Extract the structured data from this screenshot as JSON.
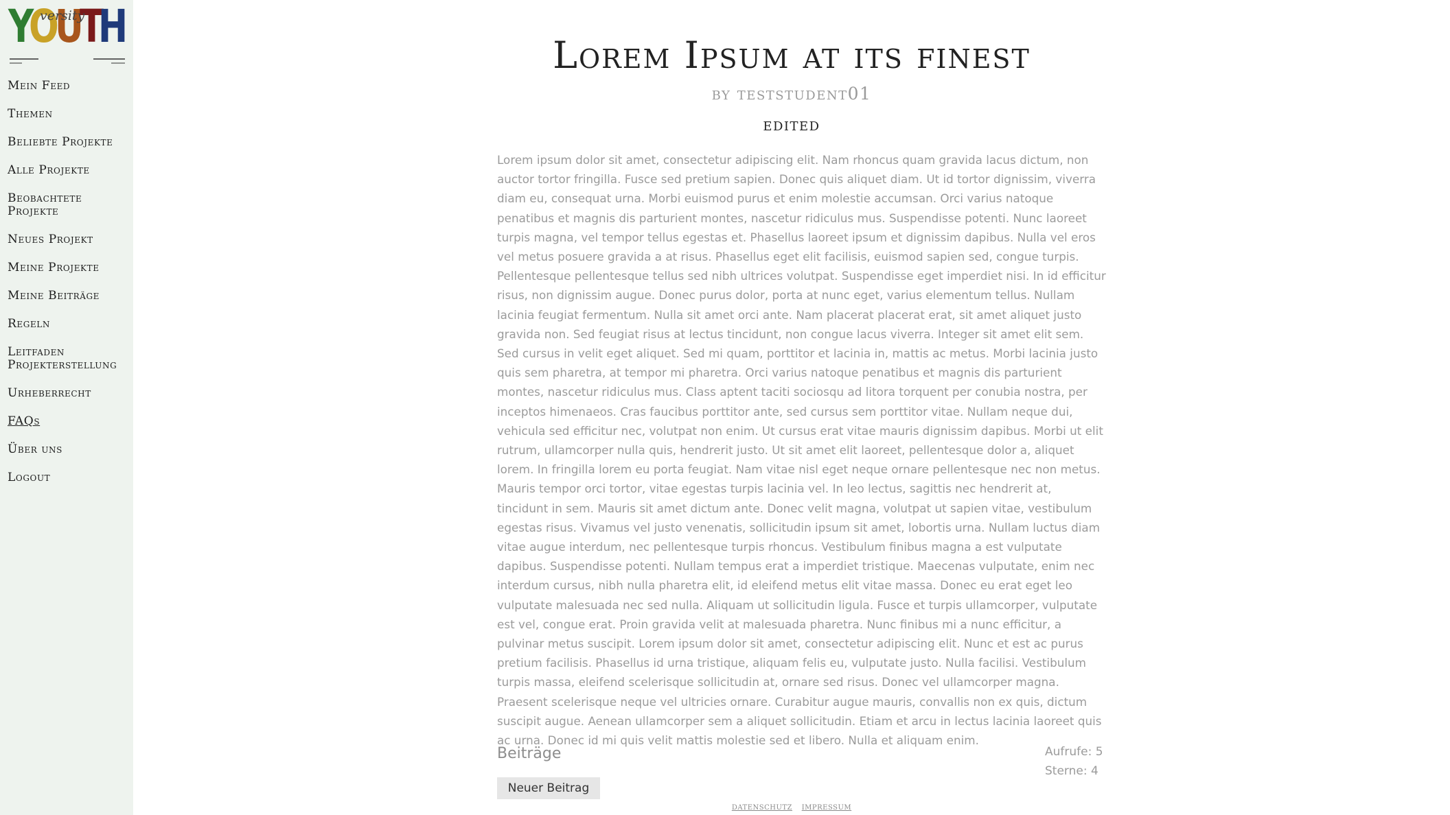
{
  "brand": {
    "logo_main": "YOUTH",
    "logo_sub": "versity",
    "logo_letter_colors": [
      "#2f7d32",
      "#c9a227",
      "#a8561c",
      "#7a1a1a",
      "#1f3a7a"
    ]
  },
  "sidebar": {
    "items": [
      {
        "label": "Mein Feed"
      },
      {
        "label": "Themen"
      },
      {
        "label": "Beliebte Projekte"
      },
      {
        "label": "Alle Projekte"
      },
      {
        "label": "Beobachtete Projekte"
      },
      {
        "label": "Neues Projekt"
      },
      {
        "label": "Meine Projekte"
      },
      {
        "label": "Meine Beiträge"
      },
      {
        "label": "Regeln"
      },
      {
        "label": "Leitfaden Projekterstellung"
      },
      {
        "label": "Urheberrecht"
      },
      {
        "label": "FAQs"
      },
      {
        "label": "Über uns"
      },
      {
        "label": "Logout"
      }
    ]
  },
  "article": {
    "title": "Lorem Ipsum at its finest",
    "byline": "by teststudent01",
    "status": "EDITED",
    "body": "Lorem ipsum dolor sit amet, consectetur adipiscing elit. Nam rhoncus quam gravida lacus dictum, non auctor tortor fringilla. Fusce sed pretium sapien. Donec quis aliquet diam. Ut id tortor dignissim, viverra diam eu, consequat urna. Morbi euismod purus et enim molestie accumsan. Orci varius natoque penatibus et magnis dis parturient montes, nascetur ridiculus mus. Suspendisse potenti. Nunc laoreet turpis magna, vel tempor tellus egestas et. Phasellus laoreet ipsum et dignissim dapibus. Nulla vel eros vel metus posuere gravida a at risus. Phasellus eget elit facilisis, euismod sapien sed, congue turpis. Pellentesque pellentesque tellus sed nibh ultrices volutpat. Suspendisse eget imperdiet nisi. In id efficitur risus, non dignissim augue. Donec purus dolor, porta at nunc eget, varius elementum tellus. Nullam lacinia feugiat fermentum. Nulla sit amet orci ante. Nam placerat placerat erat, sit amet aliquet justo gravida non. Sed feugiat risus at lectus tincidunt, non congue lacus viverra. Integer sit amet elit sem. Sed cursus in velit eget aliquet. Sed mi quam, porttitor et lacinia in, mattis ac metus. Morbi lacinia justo quis sem pharetra, at tempor mi pharetra. Orci varius natoque penatibus et magnis dis parturient montes, nascetur ridiculus mus. Class aptent taciti sociosqu ad litora torquent per conubia nostra, per inceptos himenaeos. Cras faucibus porttitor ante, sed cursus sem porttitor vitae. Nullam neque dui, vehicula sed efficitur nec, volutpat non enim. Ut cursus erat vitae mauris dignissim dapibus. Morbi ut elit rutrum, ullamcorper nulla quis, hendrerit justo. Ut sit amet elit laoreet, pellentesque dolor a, aliquet lorem. In fringilla lorem eu porta feugiat. Nam vitae nisl eget neque ornare pellentesque nec non metus. Mauris tempor orci tortor, vitae egestas turpis lacinia vel. In leo lectus, sagittis nec hendrerit at, tincidunt in sem. Mauris sit amet dictum ante. Donec velit magna, volutpat ut sapien vitae, vestibulum egestas risus. Vivamus vel justo venenatis, sollicitudin ipsum sit amet, lobortis urna. Nullam luctus diam vitae augue interdum, nec pellentesque turpis rhoncus. Vestibulum finibus magna a est vulputate dapibus. Suspendisse potenti. Nullam tempus erat a imperdiet tristique. Maecenas vulputate, enim nec interdum cursus, nibh nulla pharetra elit, id eleifend metus elit vitae massa. Donec eu erat eget leo vulputate malesuada nec sed nulla. Aliquam ut sollicitudin ligula. Fusce et turpis ullamcorper, vulputate est vel, congue erat. Proin gravida velit at malesuada pharetra. Nunc finibus mi a nunc efficitur, a pulvinar metus suscipit. Lorem ipsum dolor sit amet, consectetur adipiscing elit. Nunc et est ac purus pretium facilisis. Phasellus id urna tristique, aliquam felis eu, vulputate justo. Nulla facilisi. Vestibulum turpis massa, eleifend scelerisque sollicitudin at, ornare sed risus. Donec vel ullamcorper magna. Praesent scelerisque neque vel ultricies ornare. Curabitur augue mauris, convallis non ex quis, dictum suscipit augue. Aenean ullamcorper sem a aliquet sollicitudin. Etiam et arcu in lectus lacinia laoreet quis ac urna. Donec id mi quis velit mattis molestie sed et libero. Nulla et aliquam enim.",
    "contributions_heading": "Beiträge",
    "views": "Aufrufe: 5",
    "stars": "Sterne: 4",
    "new_post_label": "Neuer Beitrag"
  },
  "footer": {
    "privacy": "Datenschutz",
    "imprint": "Impressum"
  }
}
